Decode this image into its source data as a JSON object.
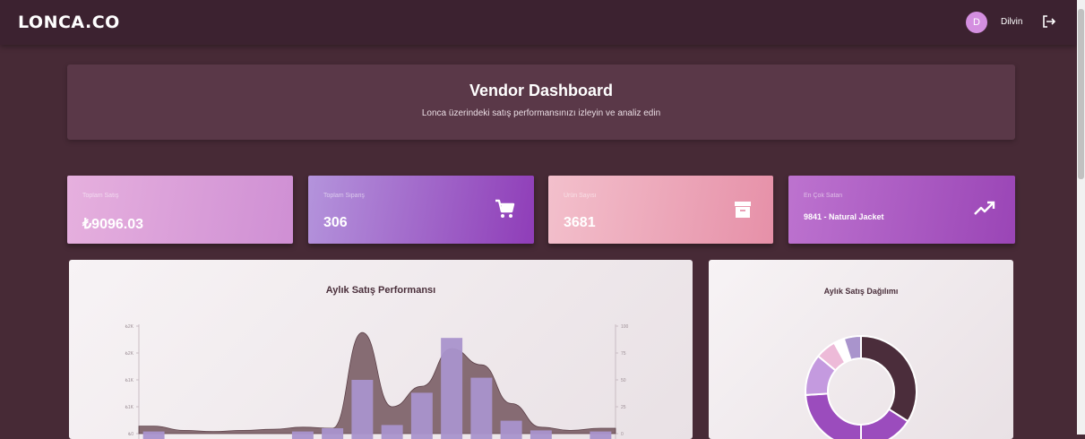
{
  "app": {
    "logo": "LONCA.CO"
  },
  "user": {
    "initial": "D",
    "name": "Dilvin"
  },
  "header": {
    "title": "Vendor Dashboard",
    "subtitle": "Lonca üzerindeki satış performansınızı izleyin ve analiz edin"
  },
  "stats": [
    {
      "label": "Toplam Satış",
      "value": "₺9096.03",
      "icon": "dollar-icon"
    },
    {
      "label": "Toplam Sipariş",
      "value": "306",
      "icon": "cart-icon"
    },
    {
      "label": "Ürün Sayısı",
      "value": "3681",
      "icon": "archive-icon"
    },
    {
      "label": "En Çok Satan",
      "value": "9841 - Natural Jacket",
      "icon": "trending-up-icon"
    }
  ],
  "colors": {
    "background": "#472a36",
    "topbar": "#3c2230",
    "bar": "#a994cc",
    "area": "#7d6168",
    "donut_dark": "#4b2d3b",
    "donut_purple": "#9b4cbd",
    "donut_lilac": "#c49adf",
    "donut_pink": "#edbad8"
  },
  "chart_data": [
    {
      "type": "bar",
      "title": "Aylık Satış Performansı",
      "y_left": {
        "ticks": [
          "₺0",
          "₺1K",
          "₺1K",
          "₺2K",
          "₺2K"
        ]
      },
      "y_right": {
        "ticks": [
          "0",
          "25",
          "50",
          "75",
          "100"
        ],
        "ylim": [
          0,
          100
        ]
      },
      "series": [
        {
          "type": "bar",
          "values": [
            2,
            0,
            0,
            0,
            0,
            2,
            5,
            50,
            8,
            38,
            89,
            52,
            12,
            3,
            0,
            2
          ]
        },
        {
          "type": "area",
          "values": [
            7,
            3,
            2,
            3,
            4,
            6,
            5,
            94,
            25,
            44,
            79,
            64,
            28,
            6,
            3,
            5
          ]
        }
      ]
    },
    {
      "type": "pie",
      "title": "Aylık Satış Dağılımı",
      "values": [
        34,
        16,
        24,
        12,
        6,
        3,
        5
      ]
    }
  ]
}
